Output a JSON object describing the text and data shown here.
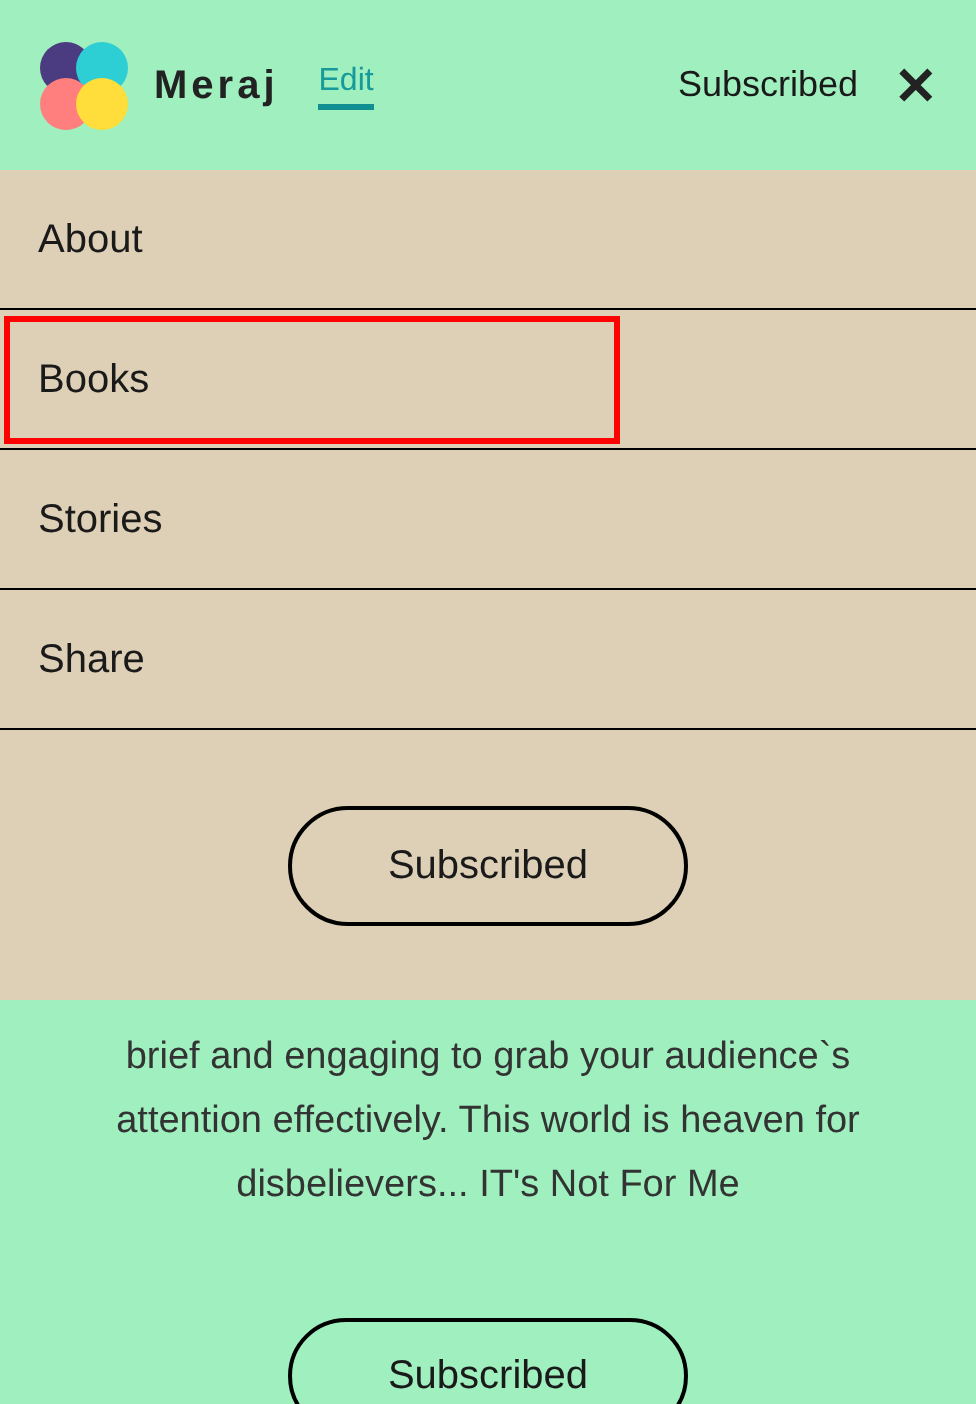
{
  "header": {
    "name": "Meraj",
    "edit_link": "Edit",
    "status": "Subscribed",
    "close": "✕"
  },
  "menu": {
    "items": [
      {
        "label": "About",
        "selected": false
      },
      {
        "label": "Books",
        "selected": true
      },
      {
        "label": "Stories",
        "selected": false
      },
      {
        "label": "Share",
        "selected": false
      }
    ],
    "button": "Subscribed"
  },
  "description": "brief and engaging to grab your audience`s attention effectively. This world is heaven for disbelievers... IT's Not For Me",
  "button": "Subscribed"
}
